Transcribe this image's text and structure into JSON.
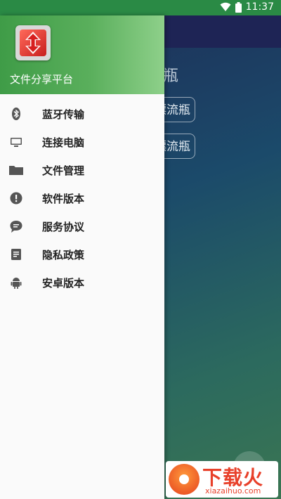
{
  "status_bar": {
    "time": "11:37"
  },
  "background_app": {
    "title_partial": "瓶",
    "button1_partial": "漂流瓶",
    "button2_partial": "漂流瓶"
  },
  "drawer": {
    "app_name": "文件分享平台",
    "menu": [
      {
        "label": "蓝牙传输",
        "icon": "bluetooth-icon"
      },
      {
        "label": "连接电脑",
        "icon": "computer-icon"
      },
      {
        "label": "文件管理",
        "icon": "folder-icon"
      },
      {
        "label": "软件版本",
        "icon": "info-alert-icon"
      },
      {
        "label": "服务协议",
        "icon": "chat-bubble-icon"
      },
      {
        "label": "隐私政策",
        "icon": "document-icon"
      },
      {
        "label": "安卓版本",
        "icon": "android-icon"
      }
    ]
  },
  "watermark": {
    "text": "下载火",
    "sub": "xiazaihuo.com"
  },
  "colors": {
    "header_green": "#3f9c47",
    "status_green": "#2a8a45",
    "watermark_red": "#e8402a"
  }
}
